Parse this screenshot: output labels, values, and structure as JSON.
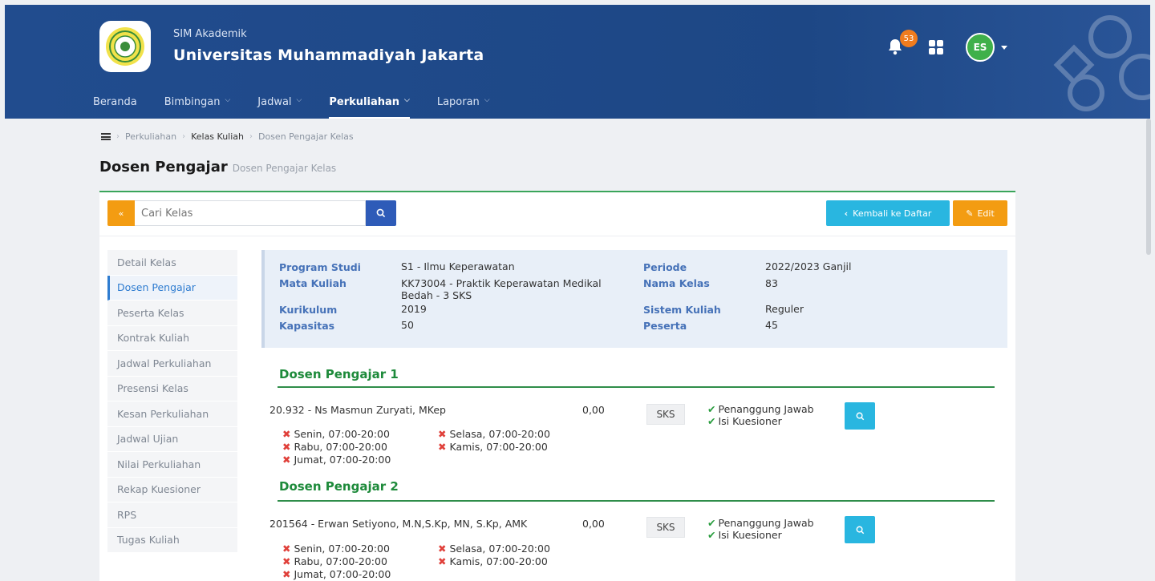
{
  "header": {
    "subtitle": "SIM Akademik",
    "title": "Universitas Muhammadiyah Jakarta",
    "notifications": "53",
    "avatar": "ES"
  },
  "nav": [
    {
      "label": "Beranda",
      "dropdown": false
    },
    {
      "label": "Bimbingan",
      "dropdown": true
    },
    {
      "label": "Jadwal",
      "dropdown": true
    },
    {
      "label": "Perkuliahan",
      "dropdown": true,
      "active": true
    },
    {
      "label": "Laporan",
      "dropdown": true
    }
  ],
  "breadcrumb": [
    "Perkuliahan",
    "Kelas Kuliah",
    "Dosen Pengajar Kelas"
  ],
  "page": {
    "title": "Dosen Pengajar",
    "subtitle": "Dosen Pengajar Kelas"
  },
  "toolbar": {
    "toggle": "«",
    "search_placeholder": "Cari Kelas",
    "back_label": "Kembali ke Daftar",
    "edit_label": "Edit"
  },
  "sidemenu": [
    "Detail Kelas",
    "Dosen Pengajar",
    "Peserta Kelas",
    "Kontrak Kuliah",
    "Jadwal Perkuliahan",
    "Presensi Kelas",
    "Kesan Perkuliahan",
    "Jadwal Ujian",
    "Nilai Perkuliahan",
    "Rekap Kuesioner",
    "RPS",
    "Tugas Kuliah"
  ],
  "info": {
    "program_studi_label": "Program Studi",
    "program_studi": "S1 - Ilmu Keperawatan",
    "mata_kuliah_label": "Mata Kuliah",
    "mata_kuliah_1": "KK73004 - Praktik Keperawatan Medikal",
    "mata_kuliah_2": "Bedah - 3 SKS",
    "kurikulum_label": "Kurikulum",
    "kurikulum": "2019",
    "kapasitas_label": "Kapasitas",
    "kapasitas": "50",
    "periode_label": "Periode",
    "periode": "2022/2023 Ganjil",
    "nama_kelas_label": "Nama Kelas",
    "nama_kelas": "83",
    "sistem_kuliah_label": "Sistem Kuliah",
    "sistem_kuliah": "Reguler",
    "peserta_label": "Peserta",
    "peserta": "45"
  },
  "dosen": [
    {
      "title": "Dosen Pengajar 1",
      "name": "20.932 - Ns Masmun Zuryati, MKep",
      "value": "0,00",
      "unit": "SKS",
      "penanggung": "Penanggung Jawab",
      "kuesioner": "Isi Kuesioner",
      "sched": [
        "Senin, 07:00-20:00",
        "Selasa, 07:00-20:00",
        "Rabu, 07:00-20:00",
        "Kamis, 07:00-20:00",
        "Jumat, 07:00-20:00"
      ]
    },
    {
      "title": "Dosen Pengajar 2",
      "name": "201564 - Erwan Setiyono, M.N,S.Kp, MN, S.Kp, AMK",
      "value": "0,00",
      "unit": "SKS",
      "penanggung": "Penanggung Jawab",
      "kuesioner": "Isi Kuesioner",
      "sched": [
        "Senin, 07:00-20:00",
        "Selasa, 07:00-20:00",
        "Rabu, 07:00-20:00",
        "Kamis, 07:00-20:00",
        "Jumat, 07:00-20:00"
      ]
    }
  ],
  "colors": {
    "header": "#1e4a8a",
    "accent_green": "#1d8a3a",
    "orange": "#f39c12",
    "cyan": "#29b6e0",
    "blue": "#2e5bb8"
  }
}
